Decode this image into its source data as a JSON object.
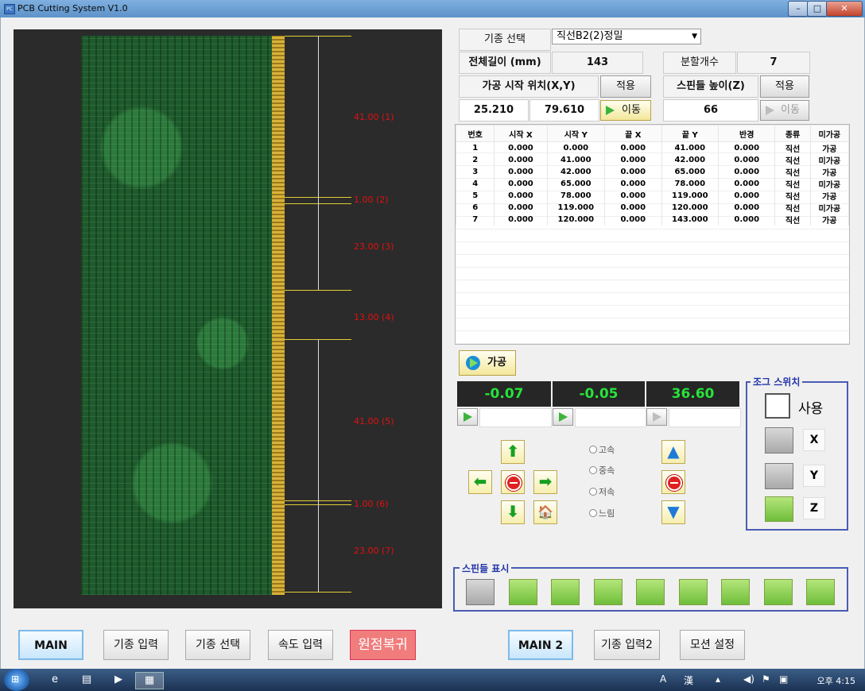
{
  "window": {
    "title": "PCB Cutting System V1.0",
    "icon": "app-icon",
    "controls": [
      "minimize-icon",
      "maximize-icon",
      "close-icon"
    ]
  },
  "segments": [
    {
      "label": "41.00   (1)"
    },
    {
      "label": "1.00   (2)"
    },
    {
      "label": "23.00   (3)"
    },
    {
      "label": "13.00   (4)"
    },
    {
      "label": "41.00   (5)"
    },
    {
      "label": "1.00   (6)"
    },
    {
      "label": "23.00   (7)"
    }
  ],
  "config": {
    "model_select_label": "기종 선택",
    "model_select_value": "직선B2(2)정밀",
    "total_length_label": "전체길이 (mm)",
    "total_length_value": "143",
    "split_count_label": "분할개수",
    "split_count_value": "7",
    "start_pos_label": "가공 시작 위치(X,Y)",
    "apply_label": "적용",
    "start_x": "25.210",
    "start_y": "79.610",
    "move_label": "이동",
    "spindle_height_label": "스핀들 높이(Z)",
    "spindle_apply_label": "적용",
    "spindle_height_value": "66",
    "spindle_move_label": "이동"
  },
  "table": {
    "headers": [
      "번호",
      "시작 X",
      "시작 Y",
      "끝 X",
      "끝 Y",
      "반경",
      "종류",
      "미가공"
    ],
    "rows": [
      [
        "1",
        "0.000",
        "0.000",
        "0.000",
        "41.000",
        "0.000",
        "직선",
        "가공"
      ],
      [
        "2",
        "0.000",
        "41.000",
        "0.000",
        "42.000",
        "0.000",
        "직선",
        "미가공"
      ],
      [
        "3",
        "0.000",
        "42.000",
        "0.000",
        "65.000",
        "0.000",
        "직선",
        "가공"
      ],
      [
        "4",
        "0.000",
        "65.000",
        "0.000",
        "78.000",
        "0.000",
        "직선",
        "미가공"
      ],
      [
        "5",
        "0.000",
        "78.000",
        "0.000",
        "119.000",
        "0.000",
        "직선",
        "가공"
      ],
      [
        "6",
        "0.000",
        "119.000",
        "0.000",
        "120.000",
        "0.000",
        "직선",
        "미가공"
      ],
      [
        "7",
        "0.000",
        "120.000",
        "0.000",
        "143.000",
        "0.000",
        "직선",
        "가공"
      ]
    ]
  },
  "process_button": "가공",
  "readouts": {
    "x": "-0.07",
    "y": "-0.05",
    "z": "36.60"
  },
  "speeds": [
    "고속",
    "중속",
    "저속",
    "느림"
  ],
  "jog": {
    "title": "조그 스위치",
    "use_label": "사용",
    "axes": [
      "X",
      "Y",
      "Z"
    ]
  },
  "spindle_display": {
    "title": "스핀들 표시"
  },
  "bottom": {
    "main": "MAIN",
    "model_input": "기종 입력",
    "model_select": "기종 선택",
    "speed_input": "속도 입력",
    "home": "원점복귀",
    "main2": "MAIN 2",
    "model_input2": "기종 입력2",
    "motion_setting": "모션 설정"
  },
  "taskbar": {
    "lang": "A",
    "clock": "오후 4:15"
  }
}
